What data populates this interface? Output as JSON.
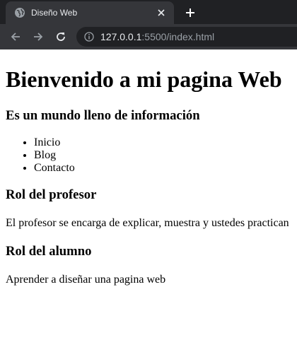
{
  "browser": {
    "tab_title": "Diseño Web",
    "url_host": "127.0.0.1",
    "url_rest": ":5500/index.html",
    "icons": {
      "favicon": "globe-icon",
      "close": "close-icon",
      "new_tab": "plus-icon",
      "back": "arrow-left-icon",
      "forward": "arrow-right-icon",
      "reload": "reload-icon",
      "info": "info-icon"
    }
  },
  "page": {
    "heading": "Bienvenido a mi pagina Web",
    "subheading": "Es un mundo lleno de información",
    "nav": [
      "Inicio",
      "Blog",
      "Contacto"
    ],
    "sections": [
      {
        "title": "Rol del profesor",
        "text": "El profesor se encarga de explicar, muestra y ustedes practican"
      },
      {
        "title": "Rol del alumno",
        "text": "Aprender a diseñar una pagina web"
      }
    ]
  }
}
